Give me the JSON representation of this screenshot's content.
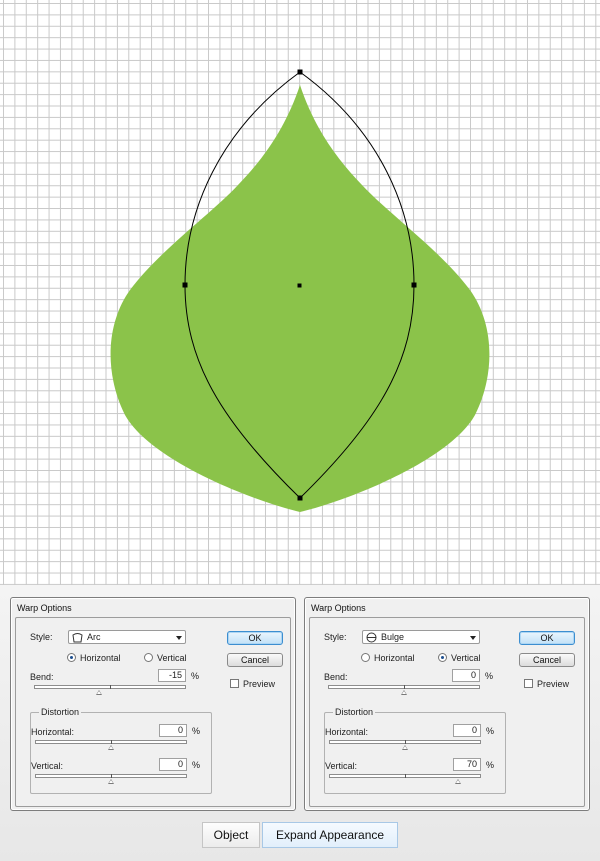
{
  "colors": {
    "leaf_fill": "#8bc34a",
    "path_stroke": "#000000",
    "grid_line": "#c9c9c9",
    "default_button_border": "#3c8ed0"
  },
  "dialogs": [
    {
      "title": "Warp Options",
      "style_label": "Style:",
      "style_value": "Arc",
      "style_icon": "arc-icon",
      "orientation_horizontal_label": "Horizontal",
      "orientation_vertical_label": "Vertical",
      "orientation_selected": "Horizontal",
      "bend_label": "Bend:",
      "bend_value": "-15",
      "bend_unit": "%",
      "bend_level": -15,
      "distortion_title": "Distortion",
      "horizontal_label": "Horizontal:",
      "horizontal_value": "0",
      "horizontal_unit": "%",
      "horizontal_level": 0,
      "vertical_label": "Vertical:",
      "vertical_value": "0",
      "vertical_unit": "%",
      "vertical_level": 0,
      "ok_label": "OK",
      "cancel_label": "Cancel",
      "preview_label": "Preview",
      "preview_checked": false
    },
    {
      "title": "Warp Options",
      "style_label": "Style:",
      "style_value": "Bulge",
      "style_icon": "bulge-icon",
      "orientation_horizontal_label": "Horizontal",
      "orientation_vertical_label": "Vertical",
      "orientation_selected": "Vertical",
      "bend_label": "Bend:",
      "bend_value": "0",
      "bend_unit": "%",
      "bend_level": 0,
      "distortion_title": "Distortion",
      "horizontal_label": "Horizontal:",
      "horizontal_value": "0",
      "horizontal_unit": "%",
      "horizontal_level": 0,
      "vertical_label": "Vertical:",
      "vertical_value": "70",
      "vertical_unit": "%",
      "vertical_level": 70,
      "ok_label": "OK",
      "cancel_label": "Cancel",
      "preview_label": "Preview",
      "preview_checked": false
    }
  ],
  "bottom_bar": {
    "object_label": "Object",
    "expand_label": "Expand Appearance"
  }
}
